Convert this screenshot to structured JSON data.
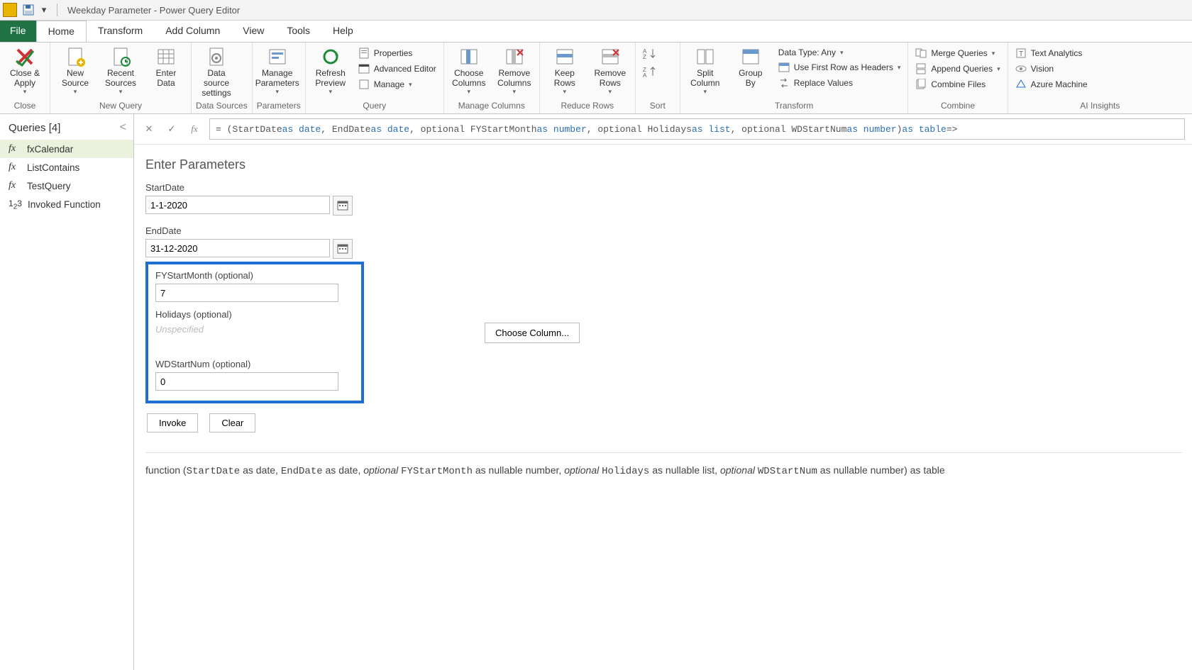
{
  "title": "Weekday Parameter - Power Query Editor",
  "tabs": {
    "file": "File",
    "home": "Home",
    "transform": "Transform",
    "addColumn": "Add Column",
    "view": "View",
    "tools": "Tools",
    "help": "Help"
  },
  "ribbon": {
    "closeApply": "Close &\nApply",
    "closeGroup": "Close",
    "newSource": "New\nSource",
    "recentSources": "Recent\nSources",
    "enterData": "Enter\nData",
    "newQuery": "New Query",
    "dataSourceSettings": "Data source\nsettings",
    "dataSources": "Data Sources",
    "manageParameters": "Manage\nParameters",
    "parameters": "Parameters",
    "refreshPreview": "Refresh\nPreview",
    "properties": "Properties",
    "advancedEditor": "Advanced Editor",
    "manage": "Manage",
    "query": "Query",
    "chooseColumns": "Choose\nColumns",
    "removeColumns": "Remove\nColumns",
    "manageColumns": "Manage Columns",
    "keepRows": "Keep\nRows",
    "removeRows": "Remove\nRows",
    "reduceRows": "Reduce Rows",
    "sort": "Sort",
    "splitColumn": "Split\nColumn",
    "groupBy": "Group\nBy",
    "dataType": "Data Type: Any",
    "useFirstRow": "Use First Row as Headers",
    "replaceValues": "Replace Values",
    "transform": "Transform",
    "mergeQueries": "Merge Queries",
    "appendQueries": "Append Queries",
    "combineFiles": "Combine Files",
    "combine": "Combine",
    "textAnalytics": "Text Analytics",
    "vision": "Vision",
    "azureML": "Azure Machine",
    "aiInsights": "AI Insights"
  },
  "queries": {
    "header": "Queries [4]",
    "items": [
      {
        "icon": "fx",
        "label": "fxCalendar",
        "selected": true
      },
      {
        "icon": "fx",
        "label": "ListContains",
        "selected": false
      },
      {
        "icon": "fx",
        "label": "TestQuery",
        "selected": false
      },
      {
        "icon": "123",
        "label": "Invoked Function",
        "selected": false
      }
    ]
  },
  "formulaBar": {
    "prefix": "= (StartDate ",
    "kw1": "as date",
    "seg1": ", EndDate ",
    "kw2": "as date",
    "seg2": ", optional FYStartMonth ",
    "kw3": "as number",
    "seg3": ", optional Holidays ",
    "kw4": "as list",
    "seg4": ", optional WDStartNum ",
    "kw5": "as number",
    "seg5": ") ",
    "kw6": "as table",
    "seg6": " =>"
  },
  "params": {
    "title": "Enter Parameters",
    "startDateLabel": "StartDate",
    "startDateValue": "1-1-2020",
    "endDateLabel": "EndDate",
    "endDateValue": "31-12-2020",
    "fyLabel": "FYStartMonth (optional)",
    "fyValue": "7",
    "holidaysLabel": "Holidays (optional)",
    "holidaysPlaceholder": "Unspecified",
    "chooseColumn": "Choose Column...",
    "wdLabel": "WDStartNum (optional)",
    "wdValue": "0",
    "invoke": "Invoke",
    "clear": "Clear"
  },
  "signature": {
    "p0": "function (",
    "p1": "StartDate",
    "p2": " as date, ",
    "p3": "EndDate",
    "p4": " as date, ",
    "p5": "optional ",
    "p6": "FYStartMonth",
    "p7": " as nullable number, ",
    "p8": "optional ",
    "p9": "Holidays",
    "p10": " as nullable list, ",
    "p11": "optional ",
    "p12": "WDStartNum",
    "p13": " as nullable number) as table"
  }
}
